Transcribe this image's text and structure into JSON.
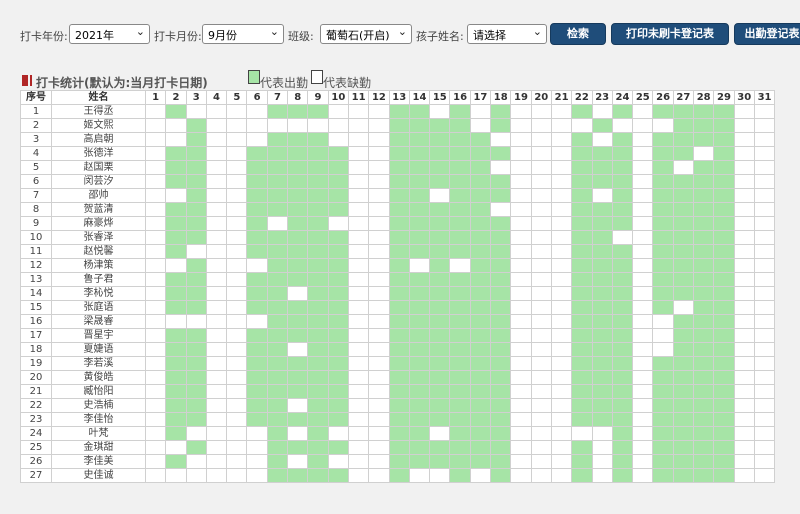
{
  "filters": {
    "year_label": "打卡年份:",
    "year_value": "2021年",
    "month_label": "打卡月份:",
    "month_value": "9月份",
    "class_label": "班级:",
    "class_value": "葡萄石(开启)",
    "child_label": "孩子姓名:",
    "child_value": "请选择"
  },
  "buttons": {
    "search": "检索",
    "print_unpunched": "打印未刷卡登记表",
    "attendance_register": "出勤登记表"
  },
  "section": {
    "title": "打卡统计(默认为:当月打卡日期)",
    "legend_present": "代表出勤",
    "legend_absent": "代表缺勤"
  },
  "colors": {
    "present": "#a6e4a6",
    "absent": "#ffffff",
    "button": "#1f4d7a"
  },
  "table": {
    "col_index": "序号",
    "col_name": "姓名",
    "days": [
      "1",
      "2",
      "3",
      "4",
      "5",
      "6",
      "7",
      "8",
      "9",
      "10",
      "11",
      "12",
      "13",
      "14",
      "15",
      "16",
      "17",
      "18",
      "19",
      "20",
      "21",
      "22",
      "23",
      "24",
      "25",
      "26",
      "27",
      "28",
      "29",
      "30",
      "31"
    ],
    "rows": [
      {
        "idx": "1",
        "name": "王得丞",
        "present": [
          2,
          7,
          8,
          9,
          13,
          14,
          16,
          18,
          22,
          24,
          26,
          27,
          28,
          29
        ]
      },
      {
        "idx": "2",
        "name": "姬文熙",
        "present": [
          3,
          13,
          14,
          15,
          16,
          18,
          23,
          27,
          28,
          29
        ]
      },
      {
        "idx": "3",
        "name": "高启朝",
        "present": [
          3,
          7,
          8,
          9,
          13,
          14,
          15,
          16,
          17,
          22,
          24,
          26,
          27,
          28,
          29
        ]
      },
      {
        "idx": "4",
        "name": "张德洋",
        "present": [
          2,
          3,
          6,
          7,
          8,
          9,
          10,
          13,
          14,
          15,
          16,
          17,
          18,
          22,
          23,
          24,
          26,
          27,
          29
        ]
      },
      {
        "idx": "5",
        "name": "赵国栗",
        "present": [
          2,
          3,
          6,
          7,
          8,
          9,
          10,
          13,
          14,
          15,
          16,
          17,
          22,
          23,
          24,
          26,
          28,
          29
        ]
      },
      {
        "idx": "6",
        "name": "闵芸汐",
        "present": [
          2,
          3,
          6,
          7,
          8,
          9,
          10,
          13,
          14,
          15,
          16,
          17,
          18,
          22,
          23,
          24,
          26,
          27,
          28,
          29
        ]
      },
      {
        "idx": "7",
        "name": "邵帅",
        "present": [
          3,
          6,
          7,
          8,
          9,
          10,
          13,
          14,
          16,
          17,
          18,
          22,
          24,
          26,
          27,
          28,
          29
        ]
      },
      {
        "idx": "8",
        "name": "贺蓝清",
        "present": [
          2,
          3,
          6,
          7,
          8,
          9,
          10,
          13,
          14,
          15,
          16,
          17,
          22,
          23,
          24,
          26,
          27,
          28,
          29
        ]
      },
      {
        "idx": "9",
        "name": "麻豪烨",
        "present": [
          2,
          3,
          6,
          8,
          9,
          13,
          14,
          15,
          16,
          17,
          18,
          22,
          23,
          24,
          26,
          27,
          28,
          29
        ]
      },
      {
        "idx": "10",
        "name": "张睿泽",
        "present": [
          2,
          3,
          6,
          7,
          8,
          9,
          10,
          13,
          14,
          15,
          16,
          17,
          18,
          22,
          23,
          26,
          27,
          28,
          29
        ]
      },
      {
        "idx": "11",
        "name": "赵悦馨",
        "present": [
          2,
          6,
          7,
          8,
          9,
          10,
          13,
          14,
          15,
          16,
          17,
          18,
          22,
          23,
          24,
          26,
          27,
          28,
          29
        ]
      },
      {
        "idx": "12",
        "name": "杨津策",
        "present": [
          3,
          7,
          8,
          9,
          10,
          13,
          15,
          17,
          18,
          22,
          23,
          24,
          26,
          27,
          28,
          29
        ]
      },
      {
        "idx": "13",
        "name": "鲁子君",
        "present": [
          2,
          3,
          6,
          7,
          8,
          9,
          10,
          13,
          14,
          15,
          16,
          17,
          18,
          22,
          23,
          24,
          26,
          27,
          28,
          29
        ]
      },
      {
        "idx": "14",
        "name": "李杺悦",
        "present": [
          2,
          3,
          6,
          7,
          9,
          10,
          13,
          14,
          15,
          16,
          17,
          18,
          22,
          23,
          24,
          26,
          27,
          28,
          29
        ]
      },
      {
        "idx": "15",
        "name": "张庭语",
        "present": [
          2,
          3,
          6,
          7,
          8,
          9,
          10,
          13,
          14,
          15,
          16,
          17,
          18,
          22,
          23,
          24,
          26,
          28,
          29
        ]
      },
      {
        "idx": "16",
        "name": "梁晟睿",
        "present": [
          7,
          8,
          9,
          10,
          13,
          14,
          15,
          16,
          17,
          18,
          22,
          23,
          24,
          27,
          28,
          29
        ]
      },
      {
        "idx": "17",
        "name": "晋星宇",
        "present": [
          2,
          3,
          6,
          7,
          8,
          9,
          10,
          13,
          14,
          15,
          16,
          17,
          18,
          22,
          23,
          24,
          27,
          28,
          29
        ]
      },
      {
        "idx": "18",
        "name": "夏婕语",
        "present": [
          2,
          3,
          6,
          7,
          9,
          10,
          13,
          14,
          15,
          16,
          17,
          18,
          22,
          23,
          24,
          27,
          28,
          29
        ]
      },
      {
        "idx": "19",
        "name": "李若溪",
        "present": [
          2,
          3,
          6,
          7,
          8,
          9,
          10,
          13,
          14,
          15,
          16,
          17,
          18,
          22,
          23,
          24,
          26,
          27,
          28,
          29
        ]
      },
      {
        "idx": "20",
        "name": "黄俊皓",
        "present": [
          2,
          3,
          6,
          7,
          8,
          9,
          10,
          13,
          14,
          15,
          16,
          17,
          18,
          22,
          23,
          24,
          26,
          27,
          28,
          29
        ]
      },
      {
        "idx": "21",
        "name": "臧怡阳",
        "present": [
          2,
          3,
          6,
          7,
          8,
          9,
          10,
          13,
          14,
          15,
          16,
          17,
          18,
          22,
          23,
          24,
          26,
          27,
          28,
          29
        ]
      },
      {
        "idx": "22",
        "name": "史浩楠",
        "present": [
          2,
          3,
          6,
          7,
          9,
          10,
          13,
          14,
          15,
          16,
          17,
          18,
          22,
          23,
          24,
          26,
          27,
          28,
          29
        ]
      },
      {
        "idx": "23",
        "name": "李佳怡",
        "present": [
          2,
          3,
          6,
          7,
          8,
          9,
          10,
          13,
          14,
          15,
          16,
          17,
          18,
          22,
          23,
          24,
          26,
          27,
          28,
          29
        ]
      },
      {
        "idx": "24",
        "name": "叶梵",
        "present": [
          2,
          7,
          9,
          13,
          14,
          16,
          17,
          18,
          24,
          26,
          27,
          28,
          29
        ]
      },
      {
        "idx": "25",
        "name": "金琪甜",
        "present": [
          3,
          7,
          8,
          9,
          10,
          13,
          14,
          15,
          16,
          17,
          18,
          22,
          24,
          26,
          27,
          28,
          29
        ]
      },
      {
        "idx": "26",
        "name": "李佳美",
        "present": [
          2,
          7,
          9,
          13,
          14,
          15,
          16,
          17,
          18,
          22,
          24,
          26,
          27,
          28,
          29
        ]
      },
      {
        "idx": "27",
        "name": "史佳诚",
        "present": [
          7,
          8,
          9,
          10,
          13,
          16,
          18,
          22,
          24,
          26,
          27,
          28,
          29
        ]
      }
    ]
  }
}
